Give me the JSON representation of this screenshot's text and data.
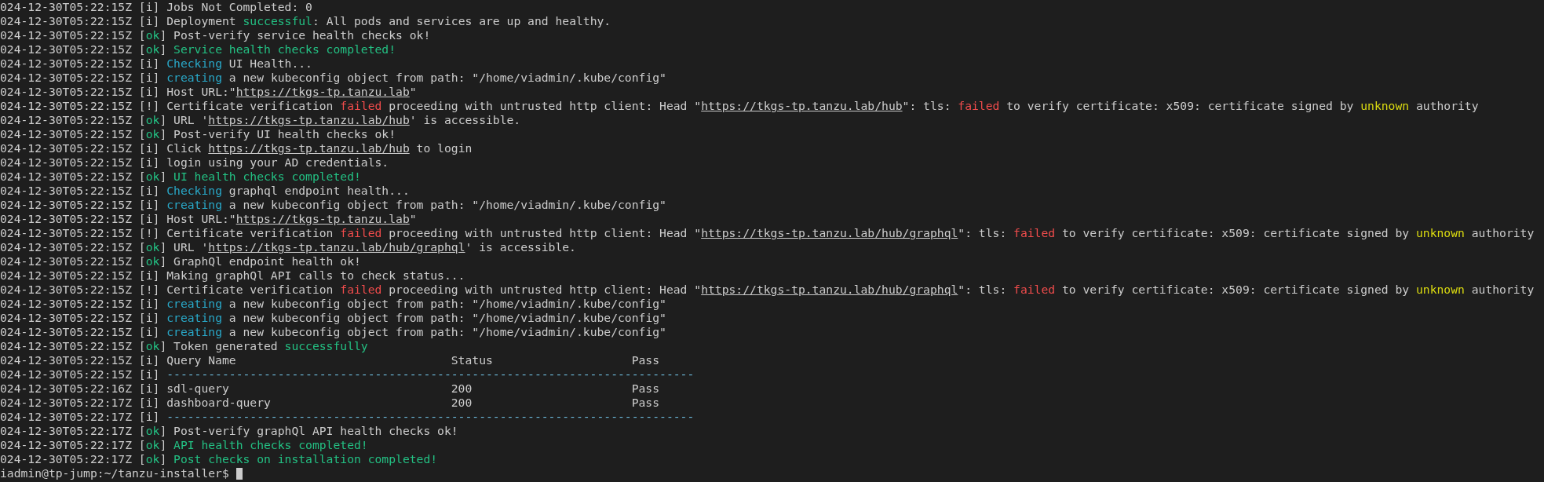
{
  "terminal": {
    "lines": [
      {
        "kind": "log",
        "time": "024-12-30T05:22:15Z",
        "parts": [
          {
            "t": "[i] ",
            "kind": "plain"
          },
          {
            "t": "Jobs Not Completed: 0",
            "kind": "plain"
          }
        ]
      },
      {
        "kind": "log",
        "time": "024-12-30T05:22:15Z",
        "parts": [
          {
            "t": "[i] ",
            "kind": "plain"
          },
          {
            "t": "Deployment ",
            "kind": "plain"
          },
          {
            "t": "successful",
            "kind": "success"
          },
          {
            "t": ": All pods and services are up and healthy.",
            "kind": "plain"
          }
        ]
      },
      {
        "kind": "log",
        "time": "024-12-30T05:22:15Z",
        "parts": [
          {
            "t": "[",
            "kind": "plain"
          },
          {
            "t": "ok",
            "kind": "success"
          },
          {
            "t": "] ",
            "kind": "plain"
          },
          {
            "t": "Post-verify service health checks ok!",
            "kind": "plain"
          }
        ]
      },
      {
        "kind": "log",
        "time": "024-12-30T05:22:15Z",
        "parts": [
          {
            "t": "[",
            "kind": "plain"
          },
          {
            "t": "ok",
            "kind": "success"
          },
          {
            "t": "] ",
            "kind": "plain"
          },
          {
            "t": "Service health checks completed!",
            "kind": "success"
          }
        ]
      },
      {
        "kind": "log",
        "time": "024-12-30T05:22:15Z",
        "parts": [
          {
            "t": "[i] ",
            "kind": "plain"
          },
          {
            "t": "Checking",
            "kind": "highlight"
          },
          {
            "t": " UI Health...",
            "kind": "plain"
          }
        ]
      },
      {
        "kind": "log",
        "time": "024-12-30T05:22:15Z",
        "parts": [
          {
            "t": "[i] ",
            "kind": "plain"
          },
          {
            "t": "creating",
            "kind": "highlight"
          },
          {
            "t": " a new kubeconfig object from path: \"/home/viadmin/.kube/config\"",
            "kind": "plain"
          }
        ]
      },
      {
        "kind": "log",
        "time": "024-12-30T05:22:15Z",
        "parts": [
          {
            "t": "[i] ",
            "kind": "plain"
          },
          {
            "t": "Host URL:\"",
            "kind": "plain"
          },
          {
            "t": "https://tkgs-tp.tanzu.lab",
            "kind": "link"
          },
          {
            "t": "\"",
            "kind": "plain"
          }
        ]
      },
      {
        "kind": "log",
        "time": "024-12-30T05:22:15Z",
        "parts": [
          {
            "t": "[!] ",
            "kind": "plain"
          },
          {
            "t": "Certificate verification ",
            "kind": "plain"
          },
          {
            "t": "failed",
            "kind": "error"
          },
          {
            "t": " proceeding with untrusted http client: Head \"",
            "kind": "plain"
          },
          {
            "t": "https://tkgs-tp.tanzu.lab/hub",
            "kind": "link"
          },
          {
            "t": "\": tls: ",
            "kind": "plain"
          },
          {
            "t": "failed",
            "kind": "error"
          },
          {
            "t": " to verify certificate: x509: certificate signed by ",
            "kind": "plain"
          },
          {
            "t": "unknown",
            "kind": "warning"
          },
          {
            "t": " authority",
            "kind": "plain"
          }
        ]
      },
      {
        "kind": "log",
        "time": "024-12-30T05:22:15Z",
        "parts": [
          {
            "t": "[",
            "kind": "plain"
          },
          {
            "t": "ok",
            "kind": "success"
          },
          {
            "t": "] ",
            "kind": "plain"
          },
          {
            "t": "URL '",
            "kind": "plain"
          },
          {
            "t": "https://tkgs-tp.tanzu.lab/hub",
            "kind": "link"
          },
          {
            "t": "' is accessible.",
            "kind": "plain"
          }
        ]
      },
      {
        "kind": "log",
        "time": "024-12-30T05:22:15Z",
        "parts": [
          {
            "t": "[",
            "kind": "plain"
          },
          {
            "t": "ok",
            "kind": "success"
          },
          {
            "t": "] ",
            "kind": "plain"
          },
          {
            "t": "Post-verify UI health checks ok!",
            "kind": "plain"
          }
        ]
      },
      {
        "kind": "log",
        "time": "024-12-30T05:22:15Z",
        "parts": [
          {
            "t": "[i] ",
            "kind": "plain"
          },
          {
            "t": "Click ",
            "kind": "plain"
          },
          {
            "t": "https://tkgs-tp.tanzu.lab/hub",
            "kind": "link"
          },
          {
            "t": " to login",
            "kind": "plain"
          }
        ]
      },
      {
        "kind": "log",
        "time": "024-12-30T05:22:15Z",
        "parts": [
          {
            "t": "[i] ",
            "kind": "plain"
          },
          {
            "t": "login using your AD credentials.",
            "kind": "plain"
          }
        ]
      },
      {
        "kind": "log",
        "time": "024-12-30T05:22:15Z",
        "parts": [
          {
            "t": "[",
            "kind": "plain"
          },
          {
            "t": "ok",
            "kind": "success"
          },
          {
            "t": "] ",
            "kind": "plain"
          },
          {
            "t": "UI health checks completed!",
            "kind": "success"
          }
        ]
      },
      {
        "kind": "log",
        "time": "024-12-30T05:22:15Z",
        "parts": [
          {
            "t": "[i] ",
            "kind": "plain"
          },
          {
            "t": "Checking",
            "kind": "highlight"
          },
          {
            "t": " graphql endpoint health...",
            "kind": "plain"
          }
        ]
      },
      {
        "kind": "log",
        "time": "024-12-30T05:22:15Z",
        "parts": [
          {
            "t": "[i] ",
            "kind": "plain"
          },
          {
            "t": "creating",
            "kind": "highlight"
          },
          {
            "t": " a new kubeconfig object from path: \"/home/viadmin/.kube/config\"",
            "kind": "plain"
          }
        ]
      },
      {
        "kind": "log",
        "time": "024-12-30T05:22:15Z",
        "parts": [
          {
            "t": "[i] ",
            "kind": "plain"
          },
          {
            "t": "Host URL:\"",
            "kind": "plain"
          },
          {
            "t": "https://tkgs-tp.tanzu.lab",
            "kind": "link"
          },
          {
            "t": "\"",
            "kind": "plain"
          }
        ]
      },
      {
        "kind": "log",
        "time": "024-12-30T05:22:15Z",
        "parts": [
          {
            "t": "[!] ",
            "kind": "plain"
          },
          {
            "t": "Certificate verification ",
            "kind": "plain"
          },
          {
            "t": "failed",
            "kind": "error"
          },
          {
            "t": " proceeding with untrusted http client: Head \"",
            "kind": "plain"
          },
          {
            "t": "https://tkgs-tp.tanzu.lab/hub/graphql",
            "kind": "link"
          },
          {
            "t": "\": tls: ",
            "kind": "plain"
          },
          {
            "t": "failed",
            "kind": "error"
          },
          {
            "t": " to verify certificate: x509: certificate signed by ",
            "kind": "plain"
          },
          {
            "t": "unknown",
            "kind": "warning"
          },
          {
            "t": " authority",
            "kind": "plain"
          }
        ]
      },
      {
        "kind": "log",
        "time": "024-12-30T05:22:15Z",
        "parts": [
          {
            "t": "[",
            "kind": "plain"
          },
          {
            "t": "ok",
            "kind": "success"
          },
          {
            "t": "] ",
            "kind": "plain"
          },
          {
            "t": "URL '",
            "kind": "plain"
          },
          {
            "t": "https://tkgs-tp.tanzu.lab/hub/graphql",
            "kind": "link"
          },
          {
            "t": "' is accessible.",
            "kind": "plain"
          }
        ]
      },
      {
        "kind": "log",
        "time": "024-12-30T05:22:15Z",
        "parts": [
          {
            "t": "[",
            "kind": "plain"
          },
          {
            "t": "ok",
            "kind": "success"
          },
          {
            "t": "] ",
            "kind": "plain"
          },
          {
            "t": "GraphQl endpoint health ok!",
            "kind": "plain"
          }
        ]
      },
      {
        "kind": "log",
        "time": "024-12-30T05:22:15Z",
        "parts": [
          {
            "t": "[i] ",
            "kind": "plain"
          },
          {
            "t": "Making graphQl API calls to check status...",
            "kind": "plain"
          }
        ]
      },
      {
        "kind": "log",
        "time": "024-12-30T05:22:15Z",
        "parts": [
          {
            "t": "[!] ",
            "kind": "plain"
          },
          {
            "t": "Certificate verification ",
            "kind": "plain"
          },
          {
            "t": "failed",
            "kind": "error"
          },
          {
            "t": " proceeding with untrusted http client: Head \"",
            "kind": "plain"
          },
          {
            "t": "https://tkgs-tp.tanzu.lab/hub/graphql",
            "kind": "link"
          },
          {
            "t": "\": tls: ",
            "kind": "plain"
          },
          {
            "t": "failed",
            "kind": "error"
          },
          {
            "t": " to verify certificate: x509: certificate signed by ",
            "kind": "plain"
          },
          {
            "t": "unknown",
            "kind": "warning"
          },
          {
            "t": " authority",
            "kind": "plain"
          }
        ]
      },
      {
        "kind": "log",
        "time": "024-12-30T05:22:15Z",
        "parts": [
          {
            "t": "[i] ",
            "kind": "plain"
          },
          {
            "t": "creating",
            "kind": "highlight"
          },
          {
            "t": " a new kubeconfig object from path: \"/home/viadmin/.kube/config\"",
            "kind": "plain"
          }
        ]
      },
      {
        "kind": "log",
        "time": "024-12-30T05:22:15Z",
        "parts": [
          {
            "t": "[i] ",
            "kind": "plain"
          },
          {
            "t": "creating",
            "kind": "highlight"
          },
          {
            "t": " a new kubeconfig object from path: \"/home/viadmin/.kube/config\"",
            "kind": "plain"
          }
        ]
      },
      {
        "kind": "log",
        "time": "024-12-30T05:22:15Z",
        "parts": [
          {
            "t": "[i] ",
            "kind": "plain"
          },
          {
            "t": "creating",
            "kind": "highlight"
          },
          {
            "t": " a new kubeconfig object from path: \"/home/viadmin/.kube/config\"",
            "kind": "plain"
          }
        ]
      },
      {
        "kind": "log",
        "time": "024-12-30T05:22:15Z",
        "parts": [
          {
            "t": "[",
            "kind": "plain"
          },
          {
            "t": "ok",
            "kind": "success"
          },
          {
            "t": "] ",
            "kind": "plain"
          },
          {
            "t": "Token generated ",
            "kind": "plain"
          },
          {
            "t": "successfully",
            "kind": "success"
          }
        ]
      },
      {
        "kind": "table",
        "time": "024-12-30T05:22:15Z",
        "tag": "[i]",
        "cells": [
          "Query Name",
          "Status",
          "Pass"
        ]
      },
      {
        "kind": "rule",
        "time": "024-12-30T05:22:15Z",
        "tag": "[i]",
        "rule": "----------------------------------------------------------------------------"
      },
      {
        "kind": "table",
        "time": "024-12-30T05:22:16Z",
        "tag": "[i]",
        "cells": [
          "sdl-query",
          "200",
          "Pass"
        ]
      },
      {
        "kind": "table",
        "time": "024-12-30T05:22:17Z",
        "tag": "[i]",
        "cells": [
          "dashboard-query",
          "200",
          "Pass"
        ]
      },
      {
        "kind": "rule",
        "time": "024-12-30T05:22:17Z",
        "tag": "[i]",
        "rule": "----------------------------------------------------------------------------"
      },
      {
        "kind": "log",
        "time": "024-12-30T05:22:17Z",
        "parts": [
          {
            "t": "[",
            "kind": "plain"
          },
          {
            "t": "ok",
            "kind": "success"
          },
          {
            "t": "] ",
            "kind": "plain"
          },
          {
            "t": "Post-verify graphQl API health checks ok!",
            "kind": "plain"
          }
        ]
      },
      {
        "kind": "log",
        "time": "024-12-30T05:22:17Z",
        "parts": [
          {
            "t": "[",
            "kind": "plain"
          },
          {
            "t": "ok",
            "kind": "success"
          },
          {
            "t": "] ",
            "kind": "plain"
          },
          {
            "t": "API health checks completed!",
            "kind": "success"
          }
        ]
      },
      {
        "kind": "log",
        "time": "024-12-30T05:22:17Z",
        "parts": [
          {
            "t": "[",
            "kind": "plain"
          },
          {
            "t": "ok",
            "kind": "success"
          },
          {
            "t": "] ",
            "kind": "plain"
          },
          {
            "t": "Post checks on installation completed!",
            "kind": "success"
          }
        ]
      },
      {
        "kind": "prompt",
        "prompt": "iadmin@tp-jump:~/tanzu-installer$"
      }
    ]
  }
}
